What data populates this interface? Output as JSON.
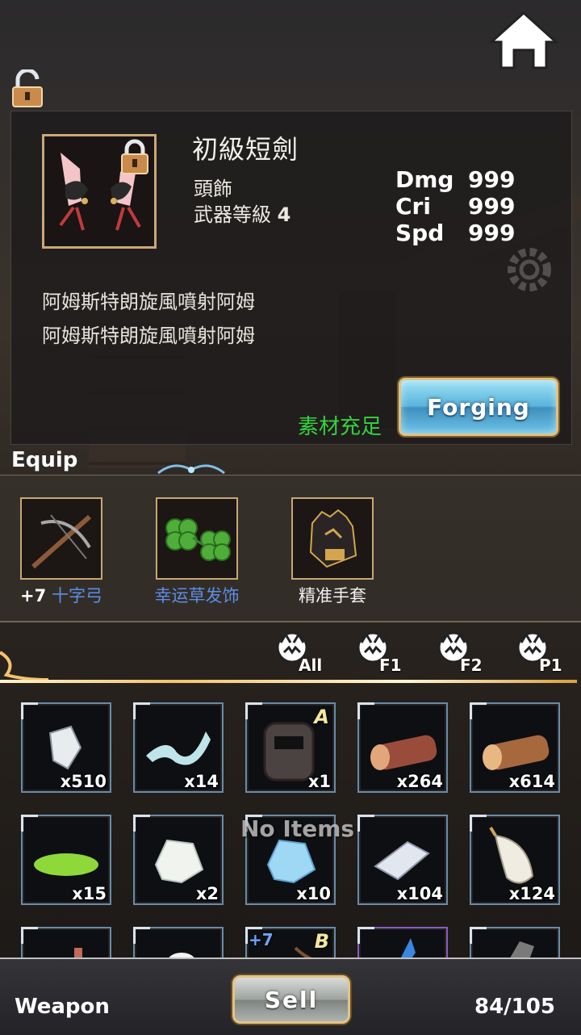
{
  "item": {
    "name": "初級短劍",
    "type": "頭飾",
    "level_label": "武器等級",
    "level_value": "4",
    "stats": [
      {
        "label": "Dmg",
        "value": "999"
      },
      {
        "label": "Cri",
        "value": "999"
      },
      {
        "label": "Spd",
        "value": "999"
      }
    ],
    "description": [
      "阿姆斯特朗旋風噴射阿姆",
      "阿姆斯特朗旋風噴射阿姆"
    ],
    "materials_status": "素材充足",
    "forge_label": "Forging"
  },
  "equip": {
    "title": "Equip",
    "slots": [
      {
        "plus": "+7",
        "name": "十字弓",
        "icon": "crossbow-icon"
      },
      {
        "name": "幸运草发饰",
        "icon": "clover-icon"
      },
      {
        "name": "精准手套",
        "icon": "glove-icon"
      }
    ]
  },
  "filters": [
    "All",
    "F1",
    "F2",
    "P1"
  ],
  "inventory": {
    "empty_text": "No Items",
    "items": [
      {
        "icon": "crystal-icon",
        "qty": "x510"
      },
      {
        "icon": "cloth-icon",
        "qty": "x14"
      },
      {
        "icon": "mask-icon",
        "qty": "x1",
        "grade": "A"
      },
      {
        "icon": "log-icon",
        "qty": "x264"
      },
      {
        "icon": "log-icon",
        "qty": "x614"
      },
      {
        "icon": "slime-icon",
        "qty": "x15"
      },
      {
        "icon": "ore-icon",
        "qty": "x2"
      },
      {
        "icon": "blue-ore-icon",
        "qty": "x10"
      },
      {
        "icon": "gem-icon",
        "qty": "x104"
      },
      {
        "icon": "feather-icon",
        "qty": "x124"
      },
      {
        "icon": "item-icon",
        "qty": ""
      },
      {
        "icon": "item-icon",
        "qty": ""
      },
      {
        "icon": "bow-icon",
        "qty": "",
        "plus": "+7",
        "grade": "B"
      },
      {
        "icon": "blue-crystal-icon",
        "qty": ""
      },
      {
        "icon": "item-icon",
        "qty": ""
      }
    ]
  },
  "footer": {
    "category": "Weapon",
    "sell_label": "Sell",
    "capacity": "84/105"
  }
}
